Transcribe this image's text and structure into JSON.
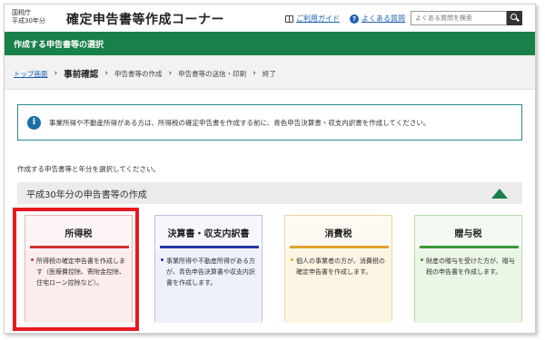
{
  "header": {
    "agency_line1": "国税庁",
    "agency_line2": "平成30年分",
    "site_title": "確定申告書等作成コーナー",
    "guide_link": "ご利用ガイド",
    "faq_link": "よくある質問",
    "search_placeholder": "よくある質問を検索",
    "icons": {
      "guide": "book-icon",
      "faq": "question-circle-icon",
      "search": "magnifier-icon"
    }
  },
  "page_title": "作成する申告書等の選択",
  "breadcrumb": {
    "items": [
      "トップ画面",
      "事前確認",
      "申告書等の作成",
      "申告書等の送信・印刷",
      "終了"
    ],
    "current_index": 1
  },
  "notice": {
    "text": "事業所得や不動産所得がある方は、所得税の確定申告書を作成する前に、青色申告決算書・収支内訳書を作成してください。"
  },
  "instruction": "作成する申告書等と年分を選択してください。",
  "section": {
    "title": "平成30年分の申告書等の作成"
  },
  "cards": [
    {
      "label": "所得税",
      "desc": "所得税の確定申告書を作成します（医療費控除、寄附金控除、住宅ローン控除など）。",
      "color": "#d32f2f"
    },
    {
      "label": "決算書・収支内訳書",
      "desc": "事業所得や不動産所得がある方が、青色申告決算書や収支内訳書を作成します。",
      "color": "#2438a8"
    },
    {
      "label": "消費税",
      "desc": "個人の事業者の方が、消費税の確定申告書を作成します。",
      "color": "#e0a32a"
    },
    {
      "label": "贈与税",
      "desc": "財産の贈与を受けた方が、贈与税の申告書を作成します。",
      "color": "#3a9a35"
    }
  ],
  "colors": {
    "brand_green": "#188049",
    "highlight_red": "#e8191e",
    "link_blue": "#1a5fb4"
  }
}
